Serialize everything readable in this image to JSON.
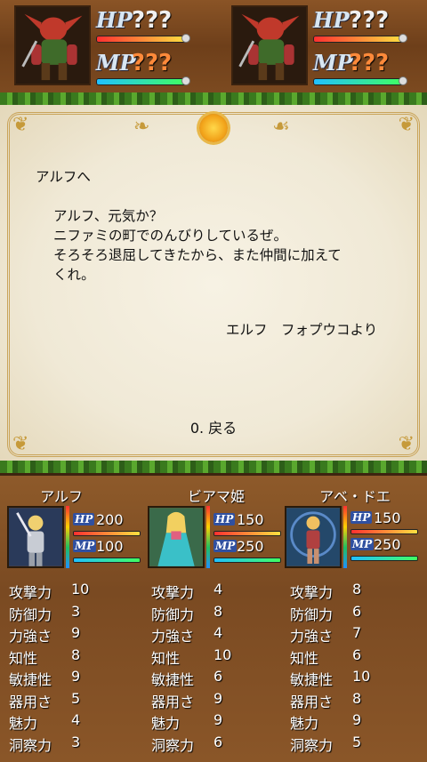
{
  "enemies": [
    {
      "hp_label": "HP",
      "hp_value": "???",
      "mp_label": "MP",
      "mp_value": "???",
      "hp_fill": 1.0,
      "mp_fill": 1.0
    },
    {
      "hp_label": "HP",
      "hp_value": "???",
      "mp_label": "MP",
      "mp_value": "???",
      "hp_fill": 1.0,
      "mp_fill": 1.0
    }
  ],
  "letter": {
    "greeting": "アルフへ",
    "body": [
      "アルフ、元気か？",
      "ニファミの町でのんびりしているぜ。",
      "そろそろ退屈してきたから、また仲間に加えて",
      "くれ。"
    ],
    "signature": "エルフ　フォプウコより",
    "back_option": "0. 戻る"
  },
  "party": [
    {
      "name": "アルフ",
      "hp_label": "HP",
      "hp": "200",
      "mp_label": "MP",
      "mp": "100",
      "hp_fill": 1.0,
      "mp_fill": 1.0,
      "stats": [
        {
          "name": "攻撃力",
          "value": "10"
        },
        {
          "name": "防御力",
          "value": "3"
        },
        {
          "name": "力強さ",
          "value": "9"
        },
        {
          "name": "知性",
          "value": "8"
        },
        {
          "name": "敏捷性",
          "value": "9"
        },
        {
          "name": "器用さ",
          "value": "5"
        },
        {
          "name": "魅力",
          "value": "4"
        },
        {
          "name": "洞察力",
          "value": "3"
        }
      ]
    },
    {
      "name": "ビアマ姫",
      "hp_label": "HP",
      "hp": "150",
      "mp_label": "MP",
      "mp": "250",
      "hp_fill": 1.0,
      "mp_fill": 1.0,
      "stats": [
        {
          "name": "攻撃力",
          "value": "4"
        },
        {
          "name": "防御力",
          "value": "8"
        },
        {
          "name": "力強さ",
          "value": "4"
        },
        {
          "name": "知性",
          "value": "10"
        },
        {
          "name": "敏捷性",
          "value": "6"
        },
        {
          "name": "器用さ",
          "value": "9"
        },
        {
          "name": "魅力",
          "value": "9"
        },
        {
          "name": "洞察力",
          "value": "6"
        }
      ]
    },
    {
      "name": "アベ・ドエ",
      "hp_label": "HP",
      "hp": "150",
      "mp_label": "MP",
      "mp": "250",
      "hp_fill": 1.0,
      "mp_fill": 1.0,
      "stats": [
        {
          "name": "攻撃力",
          "value": "8"
        },
        {
          "name": "防御力",
          "value": "6"
        },
        {
          "name": "力強さ",
          "value": "7"
        },
        {
          "name": "知性",
          "value": "6"
        },
        {
          "name": "敏捷性",
          "value": "10"
        },
        {
          "name": "器用さ",
          "value": "8"
        },
        {
          "name": "魅力",
          "value": "9"
        },
        {
          "name": "洞察力",
          "value": "5"
        }
      ]
    }
  ],
  "colors": {
    "hp_value": "#f0f0f0",
    "mp_value": "#ff8a3a",
    "parchment": "#f3eddc",
    "panel": "#7e4c22"
  }
}
